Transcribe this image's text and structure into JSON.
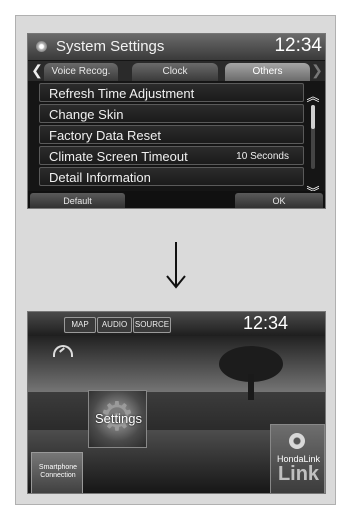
{
  "screen1": {
    "title": "System Settings",
    "clock": "12:34",
    "tabs": [
      {
        "label": "Voice Recog.",
        "active": false
      },
      {
        "label": "Clock",
        "active": false
      },
      {
        "label": "Others",
        "active": true
      }
    ],
    "items": [
      {
        "label": "Refresh Time Adjustment",
        "value": ""
      },
      {
        "label": "Change Skin",
        "value": ""
      },
      {
        "label": "Factory Data Reset",
        "value": ""
      },
      {
        "label": "Climate Screen Timeout",
        "value": "10 Seconds"
      },
      {
        "label": "Detail Information",
        "value": ""
      }
    ],
    "footer": {
      "default_label": "Default",
      "ok_label": "OK"
    }
  },
  "screen2": {
    "buttons": {
      "map": "MAP",
      "audio": "AUDIO",
      "source": "SOURCE"
    },
    "clock": "12:34",
    "tiles": {
      "settings": "Settings",
      "smartphone": "Smartphone Connection",
      "hondalink_text": "HondaLink",
      "hondalink_logo": "Link"
    }
  }
}
